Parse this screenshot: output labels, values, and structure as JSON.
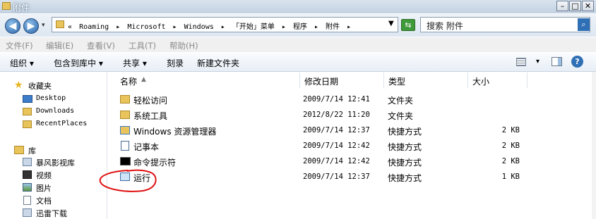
{
  "window": {
    "title": "附件"
  },
  "address": {
    "crumbs": [
      "«",
      "Roaming",
      "▸",
      "Microsoft",
      "▸",
      "Windows",
      "▸",
      "「开始」菜单",
      "▸",
      "程序",
      "▸",
      "附件",
      "▸"
    ],
    "search_placeholder": "搜索 附件"
  },
  "menu": {
    "items": [
      "文件(F)",
      "编辑(E)",
      "查看(V)",
      "工具(T)",
      "帮助(H)"
    ]
  },
  "toolbar": {
    "organize": "组织 ▾",
    "include": "包含到库中 ▾",
    "share": "共享 ▾",
    "burn": "刻录",
    "new_folder": "新建文件夹",
    "views": "▾"
  },
  "nav": {
    "favorites": "收藏夹",
    "fav_items": [
      "Desktop",
      "Downloads",
      "RecentPlaces"
    ],
    "libraries": "库",
    "lib_items": [
      "暴风影视库",
      "视频",
      "图片",
      "文档",
      "迅雷下载"
    ]
  },
  "columns": {
    "name": "名称",
    "modified": "修改日期",
    "type": "类型",
    "size": "大小"
  },
  "files": [
    {
      "name": "轻松访问",
      "date": "2009/7/14 12:41",
      "type": "文件夹",
      "size": "",
      "icon": "folder-icon"
    },
    {
      "name": "系统工具",
      "date": "2012/8/22 11:20",
      "type": "文件夹",
      "size": "",
      "icon": "folder-icon"
    },
    {
      "name": "Windows 资源管理器",
      "date": "2009/7/14 12:37",
      "type": "快捷方式",
      "size": "2 KB",
      "icon": "explorer-icon"
    },
    {
      "name": "记事本",
      "date": "2009/7/14 12:42",
      "type": "快捷方式",
      "size": "2 KB",
      "icon": "notepad-icon"
    },
    {
      "name": "命令提示符",
      "date": "2009/7/14 12:42",
      "type": "快捷方式",
      "size": "2 KB",
      "icon": "cmd-icon"
    },
    {
      "name": "运行",
      "date": "2009/7/14 12:37",
      "type": "快捷方式",
      "size": "1 KB",
      "icon": "run-icon"
    }
  ]
}
